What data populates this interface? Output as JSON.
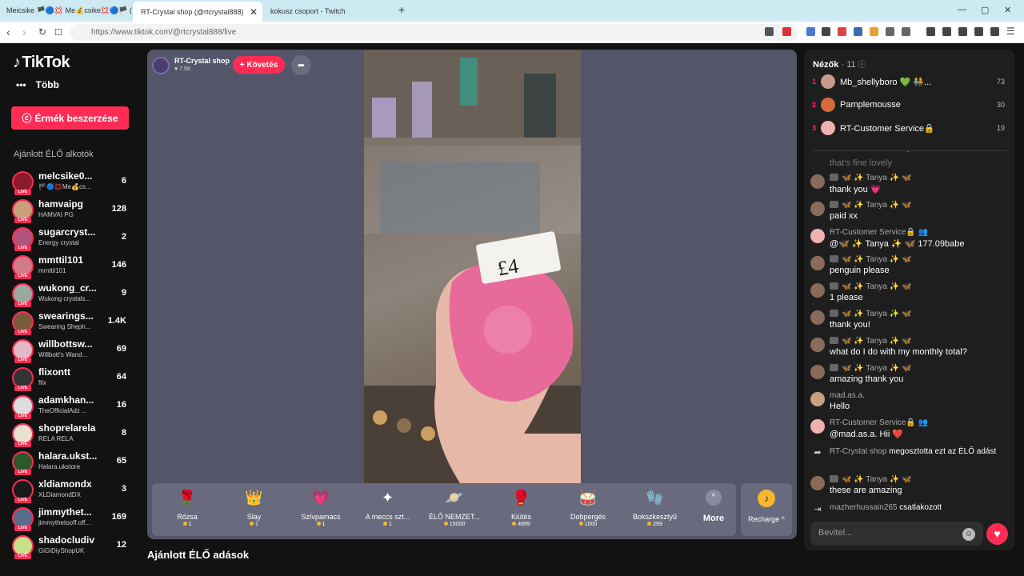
{
  "browser": {
    "tabs": [
      {
        "label": "Meicsike 🏴🔵💢 Me💰csike💢🔵🏴 (@..."
      },
      {
        "label": "RT-Crystal shop (@rtcrystal888)"
      },
      {
        "label": "kokusz csoport - Twitch"
      }
    ],
    "new_tab": "+",
    "url": "https://www.tiktok.com/@rtcrystal888/live",
    "window_controls": [
      "—",
      "▢",
      "✕"
    ]
  },
  "sidebar": {
    "logo": "TikTok",
    "more_label": "Több",
    "coins_button": "Érmék beszerzése",
    "section_title": "Ajánlott ÉLŐ alkotók",
    "live_badge": "LIVE",
    "creators": [
      {
        "name": "melcsike0...",
        "sub": "🏴🔵💢Me💰cs...",
        "count": "6",
        "color": "#8b1a2a"
      },
      {
        "name": "hamvaipg",
        "sub": "HAMVAI PG",
        "count": "128",
        "color": "#c8a07a"
      },
      {
        "name": "sugarcryst...",
        "sub": "Energy crystal",
        "count": "2",
        "color": "#b0527a"
      },
      {
        "name": "mmttil101",
        "sub": "mmttil101",
        "count": "146",
        "color": "#d47a8a"
      },
      {
        "name": "wukong_cr...",
        "sub": "Wukong crystals...",
        "count": "9",
        "color": "#9aa8a0"
      },
      {
        "name": "swearings...",
        "sub": "Swearing Sheph...",
        "count": "1.4K",
        "color": "#7a5a3a"
      },
      {
        "name": "willbottsw...",
        "sub": "Willbott's Wand...",
        "count": "69",
        "color": "#e0b8c8"
      },
      {
        "name": "flixontt",
        "sub": "flix",
        "count": "64",
        "color": "#333"
      },
      {
        "name": "adamkhan...",
        "sub": "TheOfficialAdz ...",
        "count": "16",
        "color": "#ddd"
      },
      {
        "name": "shoprelarela",
        "sub": "RELA RELA",
        "count": "8",
        "color": "#e8e0d0"
      },
      {
        "name": "halara.ukst...",
        "sub": "Halara.ukstore",
        "count": "65",
        "color": "#2a5a2a"
      },
      {
        "name": "xldiamondx",
        "sub": "XLDiamondDX",
        "count": "3",
        "color": "#1a1a1a"
      },
      {
        "name": "jimmythet...",
        "sub": "jimmythetooff.off...",
        "count": "169",
        "color": "#5a6a8a"
      },
      {
        "name": "shadocludiv",
        "sub": "GiGiDiyShopUK",
        "count": "12",
        "color": "#c8e08a"
      }
    ]
  },
  "player": {
    "host_name": "RT-Crystal shop",
    "host_likes": "♥ 7.5K",
    "follow_button": "+ Követés",
    "gifts": [
      {
        "label": "Rózsa",
        "price": "1",
        "icon": "🌹",
        "bg": "transparent"
      },
      {
        "label": "Slay",
        "price": "1",
        "icon": "👑",
        "bg": "transparent"
      },
      {
        "label": "Szívpamacs",
        "price": "1",
        "icon": "💗",
        "bg": "transparent"
      },
      {
        "label": "A meccs szt...",
        "price": "1",
        "icon": "✦",
        "bg": "transparent"
      },
      {
        "label": "ÉLŐ NEMZET...",
        "price": "15000",
        "icon": "🪐",
        "bg": "transparent"
      },
      {
        "label": "Kiütés",
        "price": "4999",
        "icon": "🥊",
        "bg": "transparent"
      },
      {
        "label": "Dobpergés",
        "price": "1000",
        "icon": "🥁",
        "bg": "transparent"
      },
      {
        "label": "Bokszkesztyű",
        "price": "299",
        "icon": "🧤",
        "bg": "transparent"
      }
    ],
    "more_label": "More",
    "recharge_label": "Recharge ^"
  },
  "recommended_title": "Ajánlott ÉLŐ adások",
  "chat": {
    "viewers_title": "Nézők",
    "viewers_count": "· 11",
    "top_viewers": [
      {
        "rank": "1",
        "name": "Mb_shellyboro 💚 🧑‍🤝‍🧑...",
        "score": "73",
        "color": "#c89a8a"
      },
      {
        "rank": "2",
        "name": "Pamplemousse",
        "score": "30",
        "color": "#d46a3a"
      },
      {
        "rank": "3",
        "name": "RT-Customer Service🔒",
        "score": "19",
        "color": "#f0b0b0"
      }
    ],
    "faded_message": "that's fine lovely",
    "messages": [
      {
        "name": "🦋 ✨ Tanya ✨ 🦋",
        "text": "thank you 💗",
        "color": "#8a6a5a"
      },
      {
        "name": "🦋 ✨ Tanya ✨ 🦋",
        "text": "paid xx",
        "color": "#8a6a5a"
      },
      {
        "name": "RT-Customer Service🔒 👥",
        "text": "@🦋 ✨ Tanya ✨ 🦋 177.09babe",
        "color": "#f0b0b0"
      },
      {
        "name": "🦋 ✨ Tanya ✨ 🦋",
        "text": "penguin please",
        "color": "#8a6a5a"
      },
      {
        "name": "🦋 ✨ Tanya ✨ 🦋",
        "text": "1 please",
        "color": "#8a6a5a"
      },
      {
        "name": "🦋 ✨ Tanya ✨ 🦋",
        "text": "thank you!",
        "color": "#8a6a5a"
      },
      {
        "name": "🦋 ✨ Tanya ✨ 🦋",
        "text": "what do I do with my monthly total?",
        "color": "#8a6a5a"
      },
      {
        "name": "🦋 ✨ Tanya ✨ 🦋",
        "text": "amazing thank you",
        "color": "#8a6a5a"
      },
      {
        "name": "mad.as.a.",
        "text": "Hello",
        "color": "#c8a080"
      },
      {
        "name": "RT-Customer Service🔒 👥",
        "text": "@mad.as.a. Hii ❤️",
        "color": "#f0b0b0"
      }
    ],
    "share_event": {
      "name": "RT-Crystal shop",
      "text": "megosztotta ezt az ÉLŐ adást"
    },
    "tanya_last": {
      "name": "🦋 ✨ Tanya ✨ 🦋",
      "text": "these are amazing"
    },
    "join_event": {
      "name": "mazherhussain265",
      "text": "csatlakozott"
    },
    "input_placeholder": "Bevitel..."
  }
}
